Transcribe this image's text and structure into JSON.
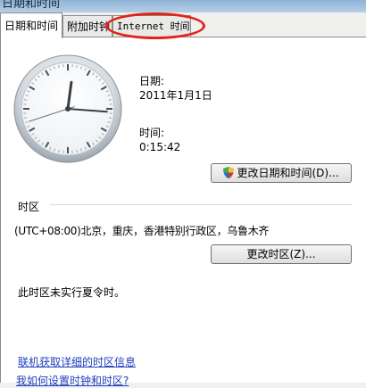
{
  "window": {
    "title": "日期和时间"
  },
  "tabs": [
    {
      "label": "日期和时间",
      "active": true
    },
    {
      "label": "附加时钟",
      "active": false
    },
    {
      "label": "Internet 时间",
      "active": false
    }
  ],
  "clock": {
    "hour": 0,
    "minute": 15,
    "second": 42
  },
  "date": {
    "label": "日期:",
    "value": "2011年1月1日"
  },
  "time": {
    "label": "时间:",
    "value": "0:15:42"
  },
  "buttons": {
    "change_datetime": "更改日期和时间(D)...",
    "change_timezone": "更改时区(Z)..."
  },
  "timezone": {
    "heading": "时区",
    "value": "(UTC+08:00)北京，重庆，香港特别行政区，乌鲁木齐",
    "dst_note": "此时区未实行夏令时。"
  },
  "links": {
    "online_info": "联机获取详细的时区信息",
    "how_to_set": "我如何设置时钟和时区?"
  },
  "colors": {
    "highlight": "#e2231a",
    "link": "#1f3fbf"
  }
}
